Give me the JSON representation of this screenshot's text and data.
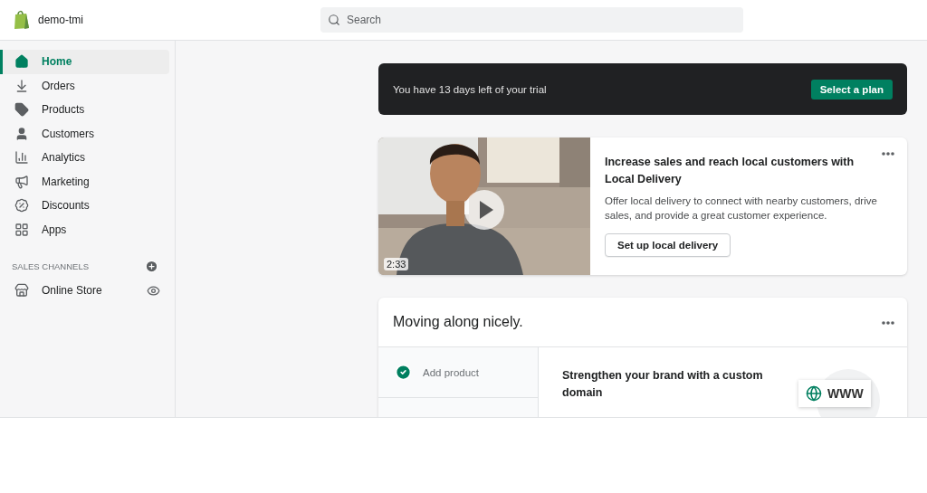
{
  "store": {
    "name": "demo-tmi"
  },
  "search": {
    "placeholder": "Search"
  },
  "nav": [
    {
      "label": "Home",
      "selected": true
    },
    {
      "label": "Orders",
      "selected": false
    },
    {
      "label": "Products",
      "selected": false
    },
    {
      "label": "Customers",
      "selected": false
    },
    {
      "label": "Analytics",
      "selected": false
    },
    {
      "label": "Marketing",
      "selected": false
    },
    {
      "label": "Discounts",
      "selected": false
    },
    {
      "label": "Apps",
      "selected": false
    }
  ],
  "sales_channels": {
    "heading": "SALES CHANNELS",
    "items": [
      {
        "label": "Online Store"
      }
    ]
  },
  "trial_banner": {
    "text": "You have 13 days left of your trial",
    "button": "Select a plan"
  },
  "promo_card": {
    "duration": "2:33",
    "title": "Increase sales and reach local customers with Local Delivery",
    "body": "Offer local delivery to connect with nearby customers, drive sales, and provide a great customer experience.",
    "button": "Set up local delivery"
  },
  "setup_card": {
    "title": "Moving along nicely.",
    "steps": [
      {
        "label": "Add product",
        "done": true
      }
    ],
    "detail_title": "Strengthen your brand with a custom domain",
    "illustration_text": "WWW"
  }
}
